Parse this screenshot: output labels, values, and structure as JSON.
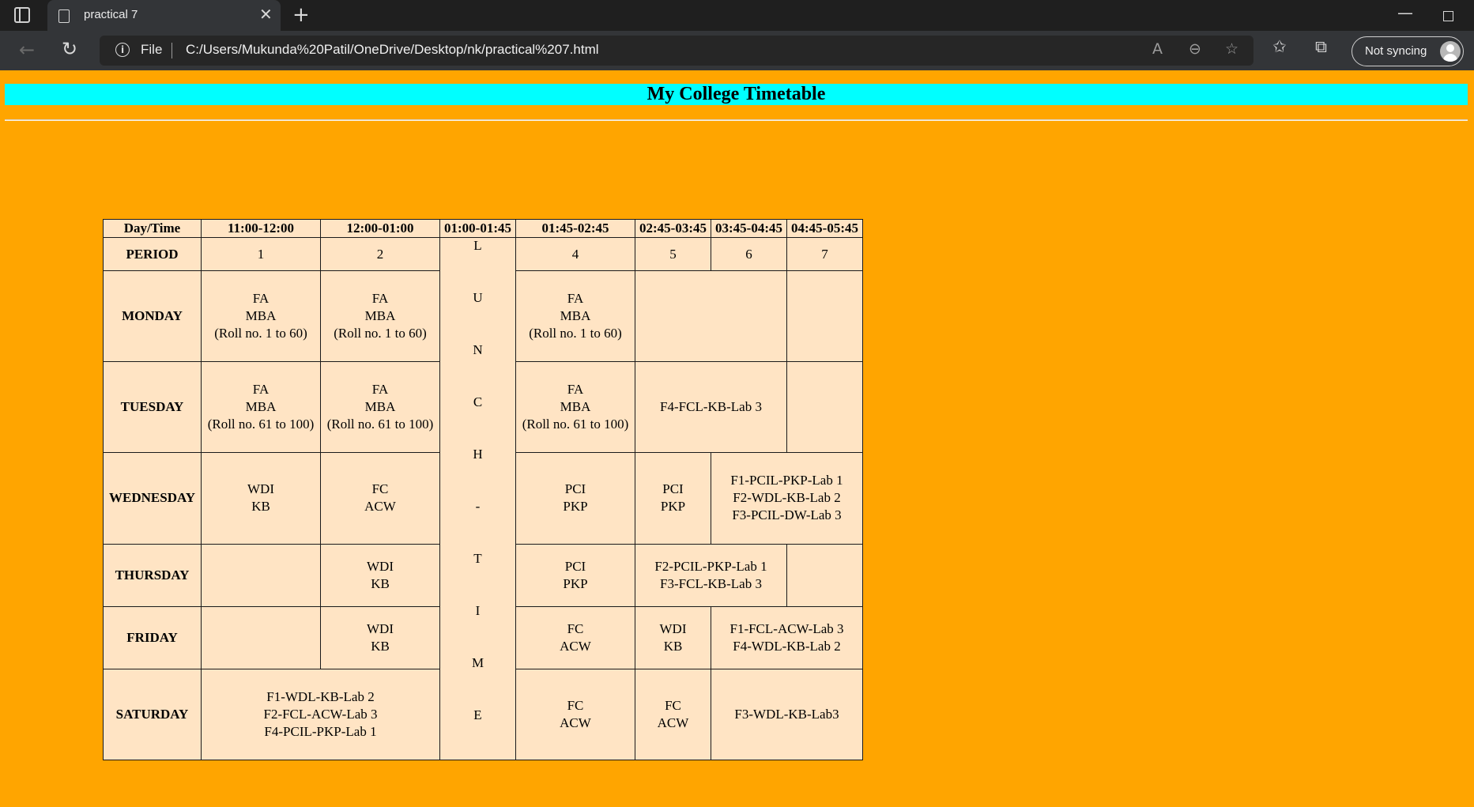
{
  "browser": {
    "tab_title": "practical 7",
    "address_scheme": "File",
    "url": "C:/Users/Mukunda%20Patil/OneDrive/Desktop/nk/practical%207.html",
    "sync_label": "Not syncing"
  },
  "page": {
    "heading": "My College Timetable",
    "background_color": "#ffa500",
    "heading_background": "#00ffff",
    "table_background": "#ffe4c4"
  },
  "timetable": {
    "header": [
      "Day/Time",
      "11:00-12:00",
      "12:00-01:00",
      "01:00-01:45",
      "01:45-02:45",
      "02:45-03:45",
      "03:45-04:45",
      "04:45-05:45"
    ],
    "period_label": "PERIOD",
    "periods": [
      "1",
      "2",
      "4",
      "5",
      "6",
      "7"
    ],
    "lunch_letters": [
      "L",
      "U",
      "N",
      "C",
      "H",
      "-",
      "T",
      "I",
      "M",
      "E"
    ],
    "days": {
      "monday": {
        "label": "MONDAY",
        "p1": [
          "FA",
          "MBA",
          "(Roll no. 1 to 60)"
        ],
        "p2": [
          "FA",
          "MBA",
          "(Roll no. 1 to 60)"
        ],
        "p4": [
          "FA",
          "MBA",
          "(Roll no. 1 to 60)"
        ]
      },
      "tuesday": {
        "label": "TUESDAY",
        "p1": [
          "FA",
          "MBA",
          "(Roll no. 61 to 100)"
        ],
        "p2": [
          "FA",
          "MBA",
          "(Roll no. 61 to 100)"
        ],
        "p4": [
          "FA",
          "MBA",
          "(Roll no. 61 to 100)"
        ],
        "p5_6": [
          "F4-FCL-KB-Lab 3"
        ]
      },
      "wednesday": {
        "label": "WEDNESDAY",
        "p1": [
          "WDI",
          "KB"
        ],
        "p2": [
          "FC",
          "ACW"
        ],
        "p4": [
          "PCI",
          "PKP"
        ],
        "p5": [
          "PCI",
          "PKP"
        ],
        "p6_7": [
          "F1-PCIL-PKP-Lab 1",
          "F2-WDL-KB-Lab 2",
          "F3-PCIL-DW-Lab 3"
        ]
      },
      "thursday": {
        "label": "THURSDAY",
        "p2": [
          "WDI",
          "KB"
        ],
        "p4": [
          "PCI",
          "PKP"
        ],
        "p5_6": [
          "F2-PCIL-PKP-Lab 1",
          "F3-FCL-KB-Lab 3"
        ]
      },
      "friday": {
        "label": "FRIDAY",
        "p2": [
          "WDI",
          "KB"
        ],
        "p4": [
          "FC",
          "ACW"
        ],
        "p5": [
          "WDI",
          "KB"
        ],
        "p6_7": [
          "F1-FCL-ACW-Lab 3",
          "F4-WDL-KB-Lab 2"
        ]
      },
      "saturday": {
        "label": "SATURDAY",
        "p1_2": [
          "F1-WDL-KB-Lab 2",
          "F2-FCL-ACW-Lab 3",
          "F4-PCIL-PKP-Lab 1"
        ],
        "p4": [
          "FC",
          "ACW"
        ],
        "p5": [
          "FC",
          "ACW"
        ],
        "p6_7": [
          "F3-WDL-KB-Lab3"
        ]
      }
    }
  }
}
